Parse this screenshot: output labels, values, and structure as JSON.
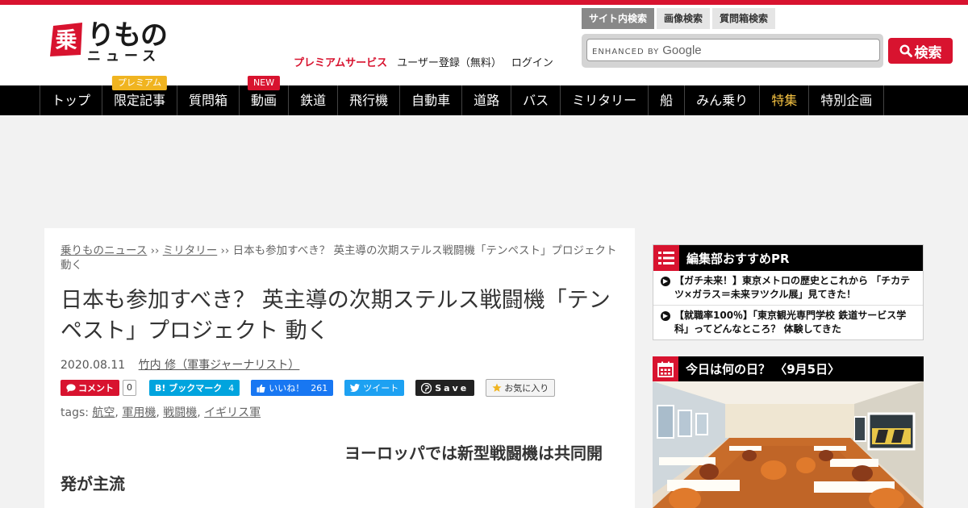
{
  "colors": {
    "brand_red": "#d8132f",
    "nav_bg": "#000000",
    "highlight_yellow": "#f5c242",
    "premium_orange": "#f0b420"
  },
  "logo": {
    "mark_char": "乗",
    "main": "りもの",
    "sub": "ニュース"
  },
  "header_links": {
    "premium": "プレミアムサービス",
    "register": "ユーザー登録（無料）",
    "login": "ログイン"
  },
  "search": {
    "tabs": [
      "サイト内検索",
      "画像検索",
      "質問箱検索"
    ],
    "enhanced_by": "ENHANCED BY",
    "google": "Google",
    "button": "検索",
    "icon": "search-icon"
  },
  "nav": {
    "items": [
      {
        "label": "トップ"
      },
      {
        "label": "限定記事",
        "badge": "プレミアム"
      },
      {
        "label": "質問箱"
      },
      {
        "label": "動画",
        "badge": "NEW"
      },
      {
        "label": "鉄道"
      },
      {
        "label": "飛行機"
      },
      {
        "label": "自動車"
      },
      {
        "label": "道路"
      },
      {
        "label": "バス"
      },
      {
        "label": "ミリタリー"
      },
      {
        "label": "船"
      },
      {
        "label": "みん乗り"
      },
      {
        "label": "特集"
      },
      {
        "label": "特別企画"
      }
    ]
  },
  "article": {
    "breadcrumb": [
      "乗りものニュース",
      "ミリタリー",
      "日本も参加すべき？ 英主導の次期ステルス戦闘機「テンペスト」プロジェクト 動く"
    ],
    "breadcrumb_sep": "››",
    "title": "日本も参加すべき？ 英主導の次期ステルス戦闘機「テンペスト」プロジェクト 動く",
    "date": "2020.08.11",
    "author": "竹内 修（軍事ジャーナリスト）",
    "share": {
      "comment_label": "コメント",
      "comment_count": "0",
      "hatena_label": "B! ブックマーク",
      "hatena_count": "4",
      "fb_label": "いいね！",
      "fb_count": "261",
      "tweet_label": "ツイート",
      "pin_label": "Save",
      "fav_label": "お気に入り"
    },
    "tags_label": "tags:",
    "tags": [
      "航空",
      "軍用機",
      "戦闘機",
      "イギリス軍"
    ],
    "lead": "ヨーロッパでは新型戦闘機は共同開発が主流"
  },
  "sidebar": {
    "pr": {
      "title": "編集部おすすめPR",
      "icon": "list-icon",
      "items": [
        "【ガチ未来！】東京メトロの歴史とこれから 「チカテツ×ガラス＝未来ヲツクル展」見てきた！",
        "【就職率100％】「東京観光専門学校 鉄道サービス学科」ってどんなところ？ 体験してきた"
      ]
    },
    "today": {
      "title": "今日は何の日？ 〈9月5日〉",
      "icon": "calendar-icon",
      "image": "dining-car-interior-photo"
    }
  }
}
